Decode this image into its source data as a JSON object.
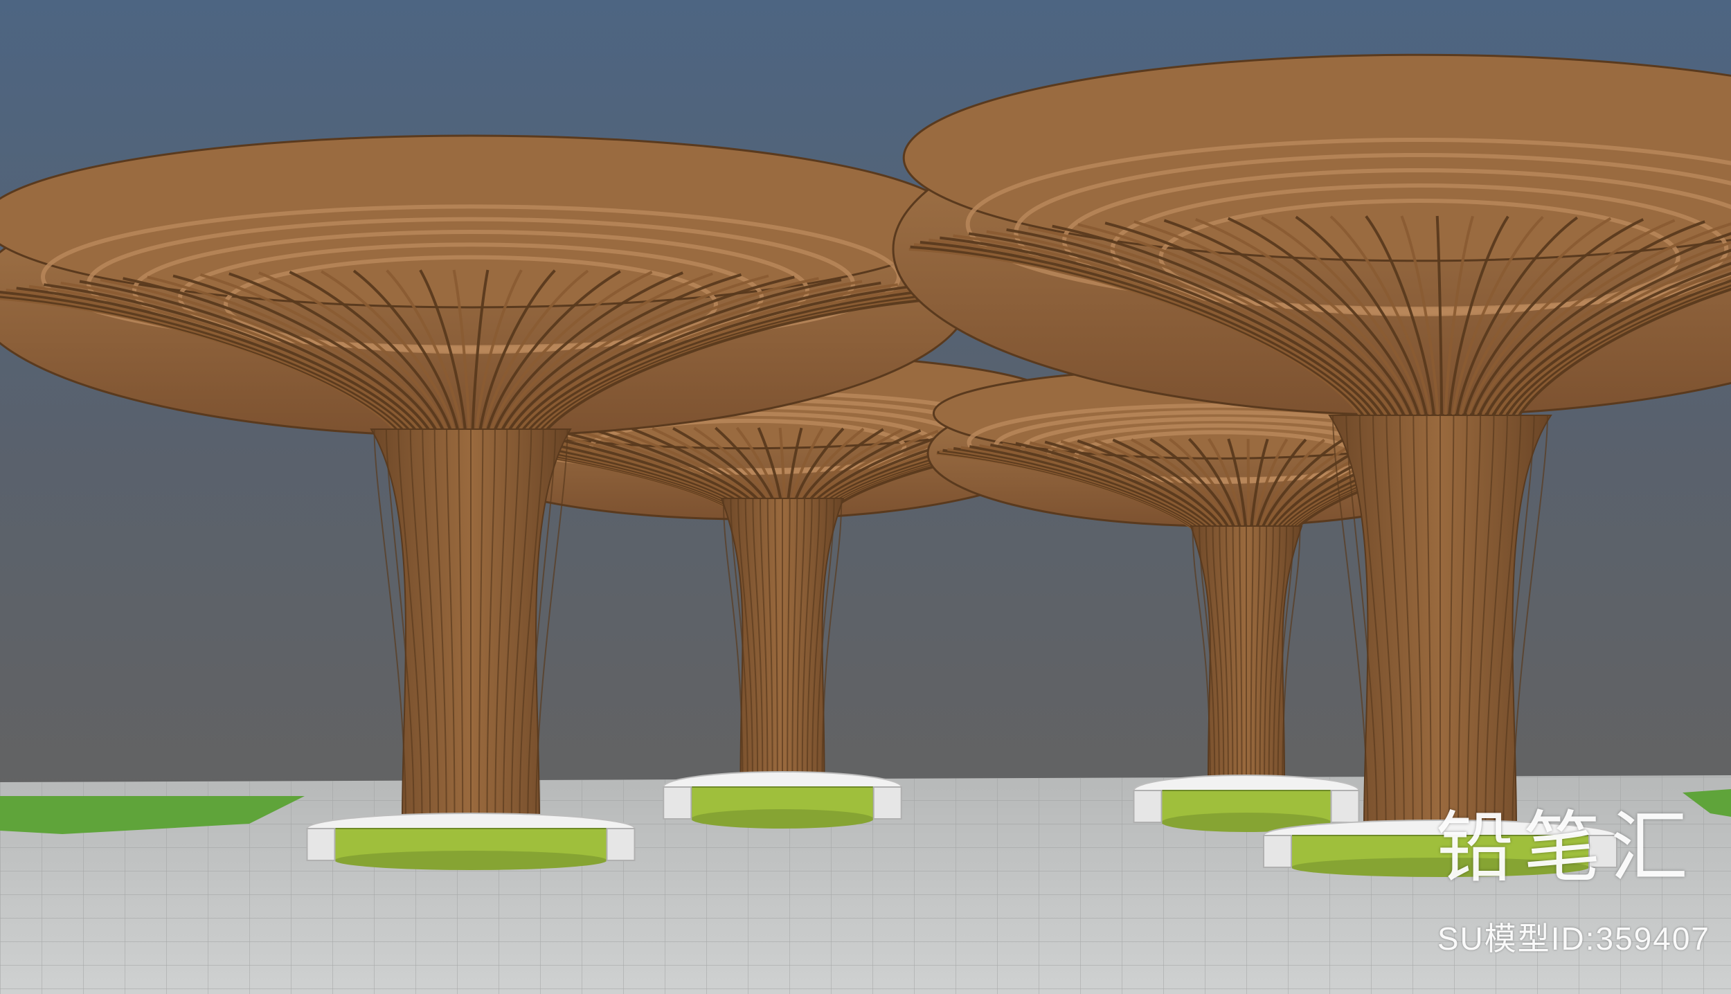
{
  "watermark": {
    "brand": "铅笔汇",
    "model_id": "SU模型ID:359407"
  },
  "colors": {
    "sky_top": "#4c6380",
    "sky_bottom": "#5e5f60",
    "ground": "#c6c8c8",
    "wood": "#8a5c33",
    "wood_dark": "#5a3a1e",
    "wood_light": "#b9875a",
    "planter_rim": "#f2f2f2",
    "planter_green": "#9fbf3c",
    "lawn": "#5fa43a"
  }
}
